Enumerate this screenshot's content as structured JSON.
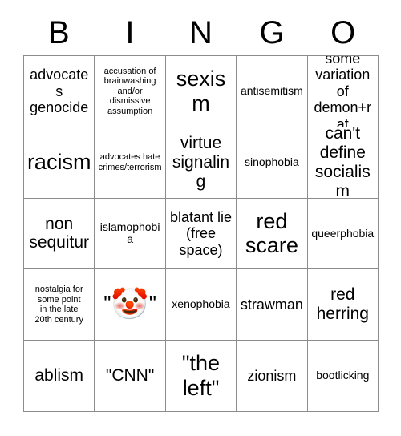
{
  "header": {
    "letters": [
      "B",
      "I",
      "N",
      "G",
      "O"
    ]
  },
  "grid": {
    "columns": 5,
    "rows": 5,
    "cells": [
      {
        "text": "advocates\ngenocide",
        "size": "fs-md",
        "free_space": false
      },
      {
        "text": "accusation of\nbrainwashing\nand/or\ndismissive\nassumption",
        "size": "fs-xs",
        "free_space": false
      },
      {
        "text": "sexism",
        "size": "fs-xl",
        "free_space": false
      },
      {
        "text": "antisemitism",
        "size": "fs-sm",
        "free_space": false
      },
      {
        "text": "some\nvariation\nof\ndemon+rat",
        "size": "fs-md",
        "free_space": false
      },
      {
        "text": "racism",
        "size": "fs-xl",
        "free_space": false
      },
      {
        "text": "advocates hate\ncrimes/terrorism",
        "size": "fs-xs",
        "free_space": false
      },
      {
        "text": "virtue\nsignaling",
        "size": "fs-lg",
        "free_space": false
      },
      {
        "text": "sinophobia",
        "size": "fs-sm",
        "free_space": false
      },
      {
        "text": "can't\ndefine\nsocialism",
        "size": "fs-lg",
        "free_space": false
      },
      {
        "text": "non\nsequitur",
        "size": "fs-lg",
        "free_space": false
      },
      {
        "text": "islamophobia",
        "size": "fs-sm",
        "free_space": false
      },
      {
        "text": "blatant lie\n(free\nspace)",
        "size": "fs-md",
        "free_space": true
      },
      {
        "text": "red\nscare",
        "size": "fs-xl",
        "free_space": false
      },
      {
        "text": "queerphobia",
        "size": "fs-sm",
        "free_space": false
      },
      {
        "text": "nostalgia for\nsome point\nin the late\n20th century",
        "size": "fs-xs",
        "free_space": false
      },
      {
        "text": "\"🤡\"",
        "size": "fs-emoji",
        "free_space": false
      },
      {
        "text": "xenophobia",
        "size": "fs-sm",
        "free_space": false
      },
      {
        "text": "strawman",
        "size": "fs-md",
        "free_space": false
      },
      {
        "text": "red\nherring",
        "size": "fs-lg",
        "free_space": false
      },
      {
        "text": "ablism",
        "size": "fs-lg",
        "free_space": false
      },
      {
        "text": "\"CNN\"",
        "size": "fs-lg",
        "free_space": false
      },
      {
        "text": "\"the\nleft\"",
        "size": "fs-xl",
        "free_space": false
      },
      {
        "text": "zionism",
        "size": "fs-md",
        "free_space": false
      },
      {
        "text": "bootlicking",
        "size": "fs-sm",
        "free_space": false
      }
    ]
  },
  "colors": {
    "background": "#ffffff",
    "text": "#000000",
    "grid_line": "#8c8c8c"
  }
}
